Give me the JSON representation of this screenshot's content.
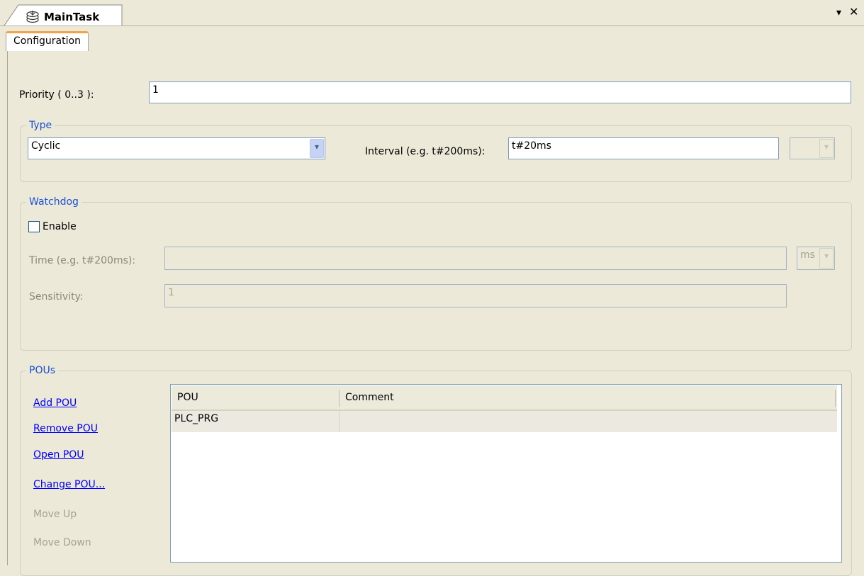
{
  "editor": {
    "tab_title": "MainTask",
    "menu_glyph": "▾",
    "close_glyph": "✕"
  },
  "tabs": [
    {
      "label": "Configuration",
      "active": true
    }
  ],
  "priority": {
    "label": "Priority ( 0..3 ):",
    "value": "1"
  },
  "type_group": {
    "title": "Type",
    "type_value": "Cyclic",
    "interval_label": "Interval (e.g. t#200ms):",
    "interval_value": "t#20ms",
    "unit_value": ""
  },
  "watchdog": {
    "title": "Watchdog",
    "enable_label": "Enable",
    "enable_checked": false,
    "time_label": "Time (e.g. t#200ms):",
    "time_value": "",
    "time_unit": "ms",
    "sensitivity_label": "Sensitivity:",
    "sensitivity_value": "1"
  },
  "pous": {
    "title": "POUs",
    "actions": {
      "add": "Add POU",
      "remove": "Remove POU",
      "open": "Open POU",
      "change": "Change POU...",
      "move_up": "Move Up",
      "move_down": "Move Down"
    },
    "columns": [
      "POU",
      "Comment"
    ],
    "rows": [
      {
        "pou": "PLC_PRG",
        "comment": ""
      }
    ]
  },
  "colors": {
    "background": "#ece9d8",
    "group_title": "#1a4fd6",
    "link": "#0000ff",
    "active_tab_accent": "#f2a443"
  },
  "icons": {
    "tab_icon": "task-icon",
    "dropdown": "chevron-down-icon"
  }
}
